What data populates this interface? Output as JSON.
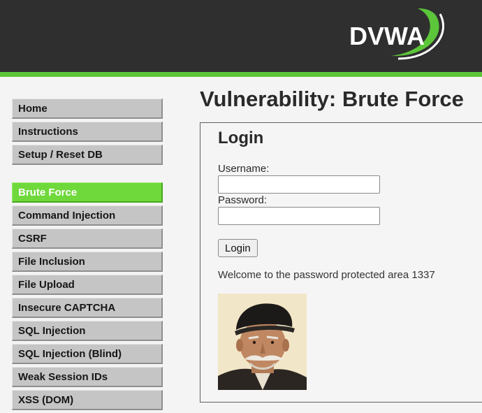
{
  "header": {
    "logo_text": "DVWA",
    "accent_color": "#5cc63a",
    "background_color": "#2f2f2f"
  },
  "sidebar": {
    "groups": [
      [
        "Home",
        "Instructions",
        "Setup / Reset DB"
      ],
      [
        "Brute Force",
        "Command Injection",
        "CSRF",
        "File Inclusion",
        "File Upload",
        "Insecure CAPTCHA",
        "SQL Injection",
        "SQL Injection (Blind)",
        "Weak Session IDs",
        "XSS (DOM)"
      ]
    ],
    "active_item": "Brute Force",
    "active_color": "#6fd93b"
  },
  "main": {
    "title": "Vulnerability: Brute Force",
    "login": {
      "heading": "Login",
      "username_label": "Username:",
      "username_value": "",
      "password_label": "Password:",
      "password_value": "",
      "button_label": "Login",
      "welcome_message": "Welcome to the password protected area 1337",
      "avatar_icon": "user-photo-icon"
    }
  }
}
